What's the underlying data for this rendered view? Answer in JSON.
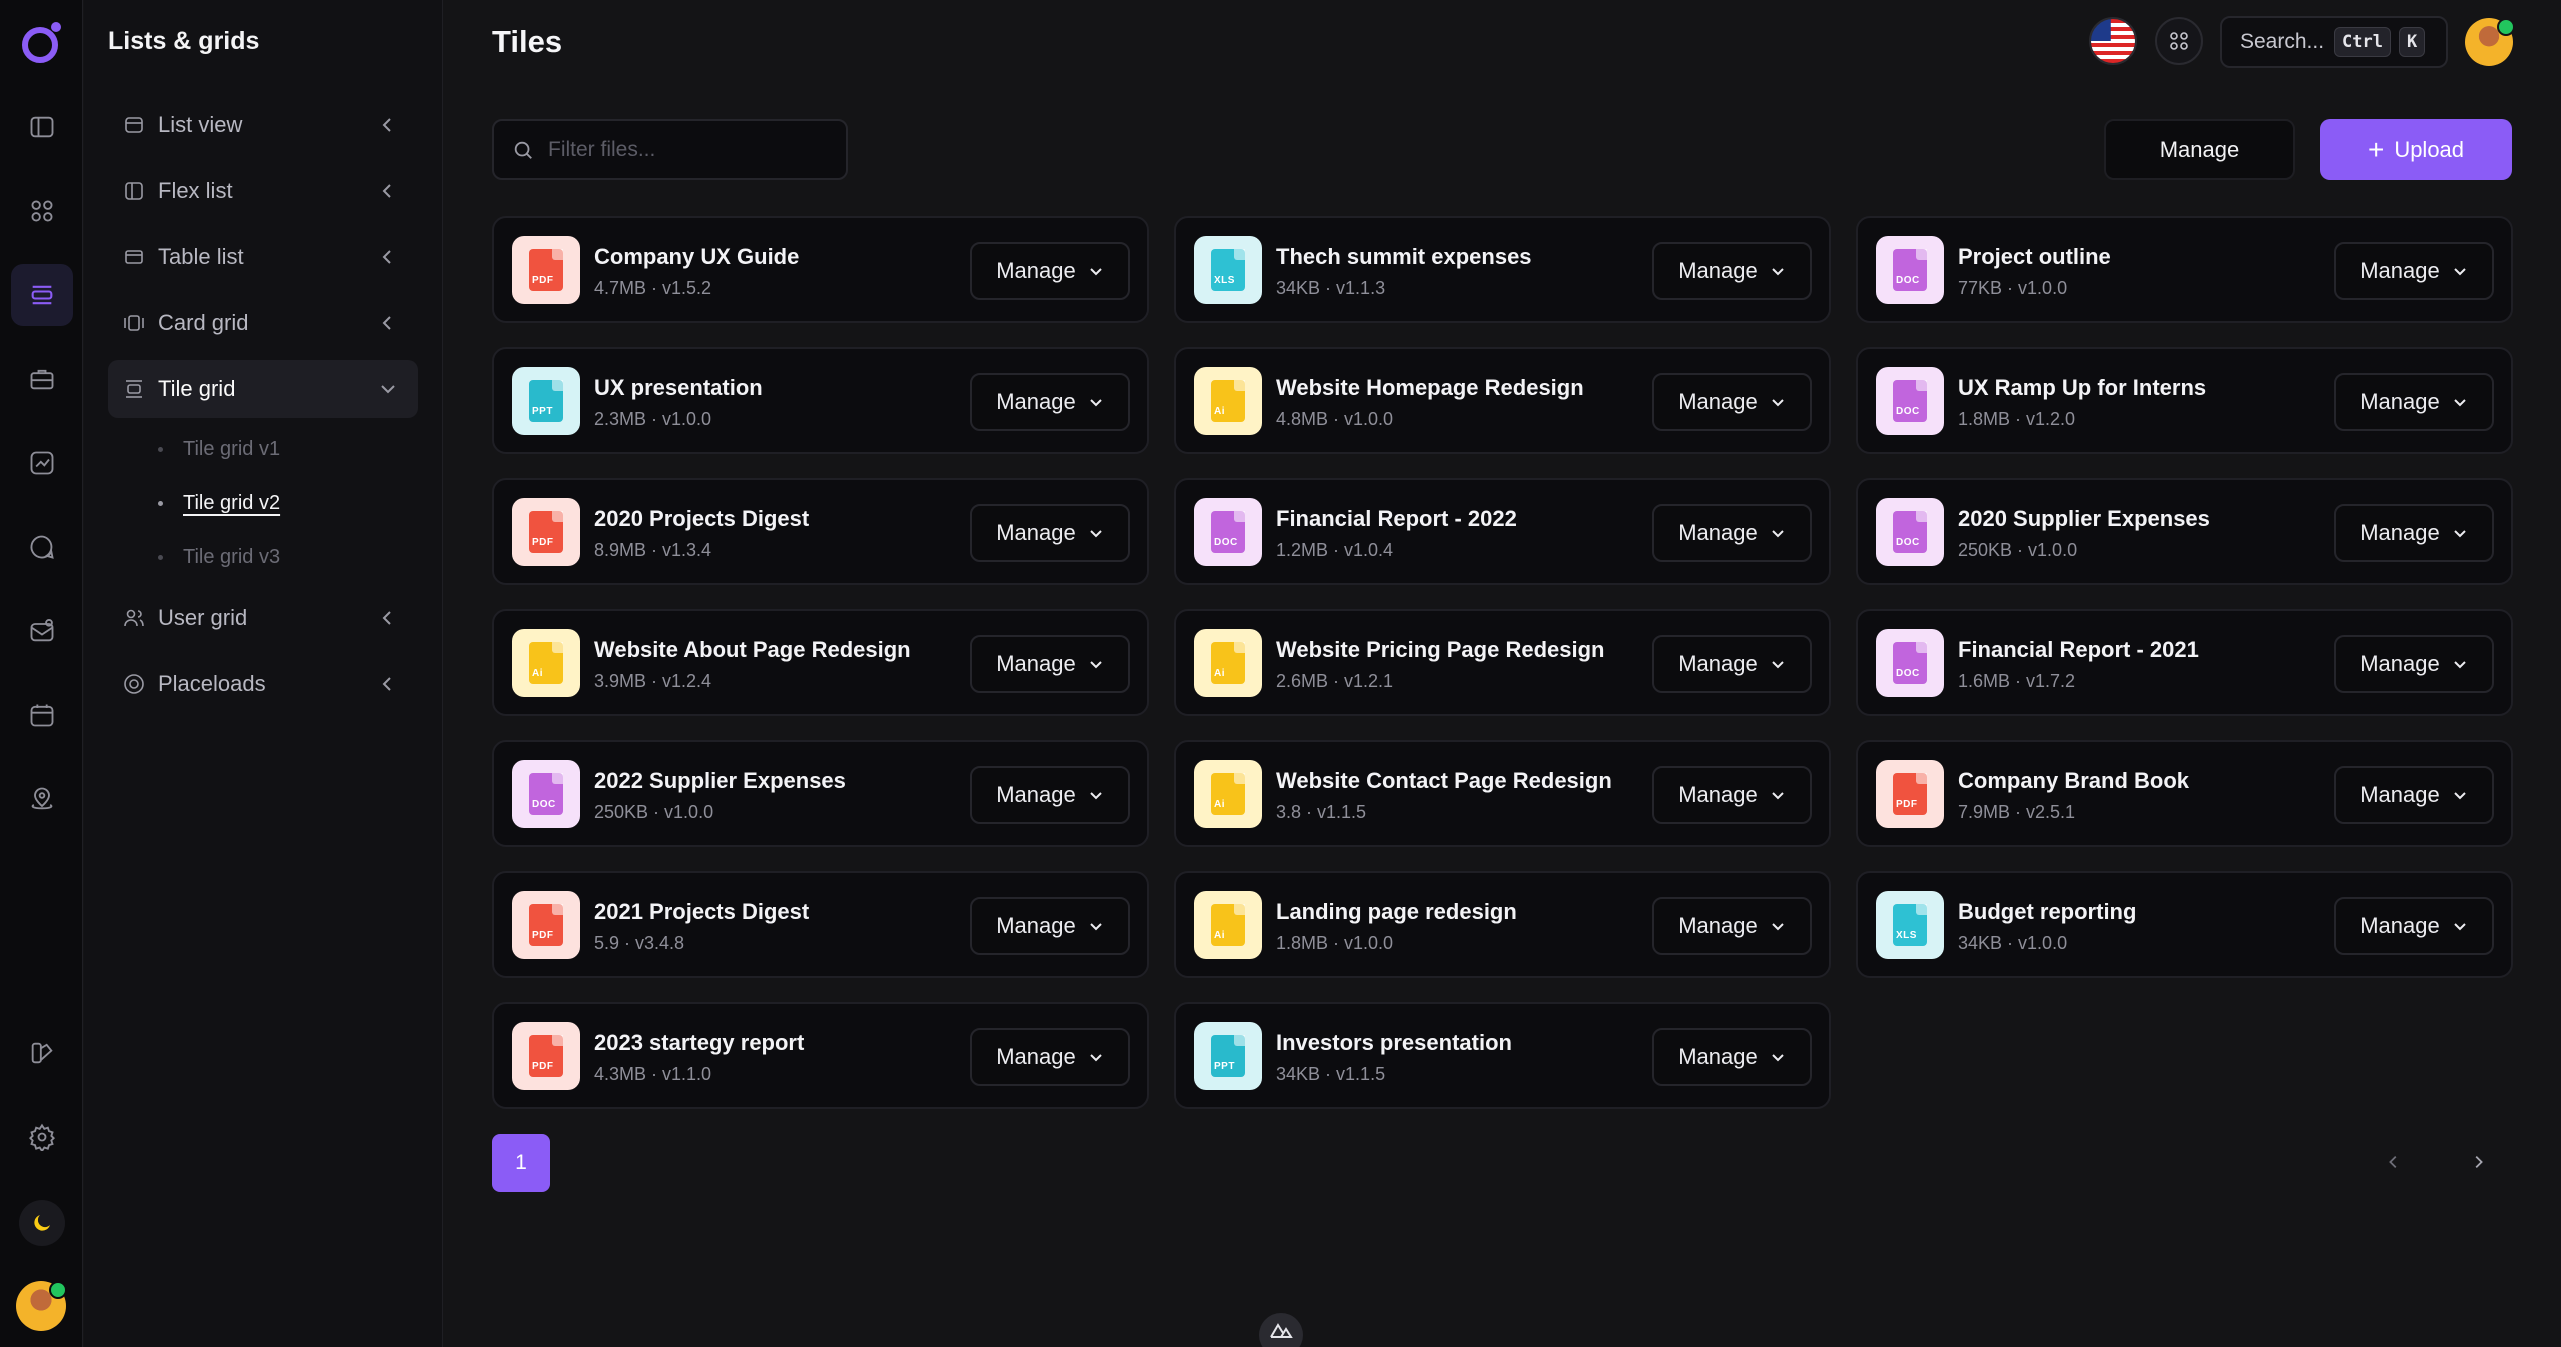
{
  "rail": {
    "icons": [
      "logo-icon",
      "sidebar-panel-icon",
      "grid-icon",
      "list-layout-icon",
      "briefcase-icon",
      "chart-icon",
      "chat-icon",
      "mail-icon",
      "calendar-icon",
      "map-pin-icon",
      "brush-icon",
      "gear-icon",
      "moon-icon"
    ],
    "accent": "#8b5cf6"
  },
  "sidebar": {
    "title": "Lists & grids",
    "items": [
      {
        "label": "List view",
        "icon": "list-icon"
      },
      {
        "label": "Flex list",
        "icon": "columns-icon"
      },
      {
        "label": "Table list",
        "icon": "table-icon"
      },
      {
        "label": "Card grid",
        "icon": "card-grid-icon"
      },
      {
        "label": "Tile grid",
        "icon": "tile-grid-icon"
      },
      {
        "label": "User grid",
        "icon": "users-icon"
      },
      {
        "label": "Placeloads",
        "icon": "placeload-icon"
      }
    ],
    "sub_items": [
      "Tile grid v1",
      "Tile grid v2",
      "Tile grid v3"
    ]
  },
  "header": {
    "title": "Tiles",
    "search_label": "Search...",
    "kbd_ctrl": "Ctrl",
    "kbd_k": "K"
  },
  "toolbar": {
    "filter_placeholder": "Filter files...",
    "manage_label": "Manage",
    "upload_label": "Upload"
  },
  "files": [
    {
      "name": "Company UX Guide",
      "size": "4.7MB",
      "version": "v1.5.2",
      "type": "pdf",
      "ext": "PDF"
    },
    {
      "name": "Thech summit expenses",
      "size": "34KB",
      "version": "v1.1.3",
      "type": "xls",
      "ext": "XLS"
    },
    {
      "name": "Project outline",
      "size": "77KB",
      "version": "v1.0.0",
      "type": "doc",
      "ext": "DOC"
    },
    {
      "name": "UX presentation",
      "size": "2.3MB",
      "version": "v1.0.0",
      "type": "ppt",
      "ext": "PPT"
    },
    {
      "name": "Website Homepage Redesign",
      "size": "4.8MB",
      "version": "v1.0.0",
      "type": "ai",
      "ext": "Ai"
    },
    {
      "name": "UX Ramp Up for Interns",
      "size": "1.8MB",
      "version": "v1.2.0",
      "type": "doc",
      "ext": "DOC"
    },
    {
      "name": "2020 Projects Digest",
      "size": "8.9MB",
      "version": "v1.3.4",
      "type": "pdf",
      "ext": "PDF"
    },
    {
      "name": "Financial Report - 2022",
      "size": "1.2MB",
      "version": "v1.0.4",
      "type": "doc",
      "ext": "DOC"
    },
    {
      "name": "2020 Supplier Expenses",
      "size": "250KB",
      "version": "v1.0.0",
      "type": "doc",
      "ext": "DOC"
    },
    {
      "name": "Website About Page Redesign",
      "size": "3.9MB",
      "version": "v1.2.4",
      "type": "ai",
      "ext": "Ai"
    },
    {
      "name": "Website Pricing Page Redesign",
      "size": "2.6MB",
      "version": "v1.2.1",
      "type": "ai",
      "ext": "Ai"
    },
    {
      "name": "Financial Report - 2021",
      "size": "1.6MB",
      "version": "v1.7.2",
      "type": "doc",
      "ext": "DOC"
    },
    {
      "name": "2022 Supplier Expenses",
      "size": "250KB",
      "version": "v1.0.0",
      "type": "doc",
      "ext": "DOC"
    },
    {
      "name": "Website Contact Page Redesign",
      "size": "3.8",
      "version": "v1.1.5",
      "type": "ai",
      "ext": "Ai"
    },
    {
      "name": "Company Brand Book",
      "size": "7.9MB",
      "version": "v2.5.1",
      "type": "pdf",
      "ext": "PDF"
    },
    {
      "name": "2021 Projects Digest",
      "size": "5.9",
      "version": "v3.4.8",
      "type": "pdf",
      "ext": "PDF"
    },
    {
      "name": "Landing page redesign",
      "size": "1.8MB",
      "version": "v1.0.0",
      "type": "ai",
      "ext": "Ai"
    },
    {
      "name": "Budget reporting",
      "size": "34KB",
      "version": "v1.0.0",
      "type": "xls",
      "ext": "XLS"
    },
    {
      "name": "2023 startegy report",
      "size": "4.3MB",
      "version": "v1.1.0",
      "type": "pdf",
      "ext": "PDF"
    },
    {
      "name": "Investors presentation",
      "size": "34KB",
      "version": "v1.1.5",
      "type": "ppt",
      "ext": "PPT"
    }
  ],
  "tile_manage_label": "Manage",
  "pagination": {
    "current": "1"
  }
}
